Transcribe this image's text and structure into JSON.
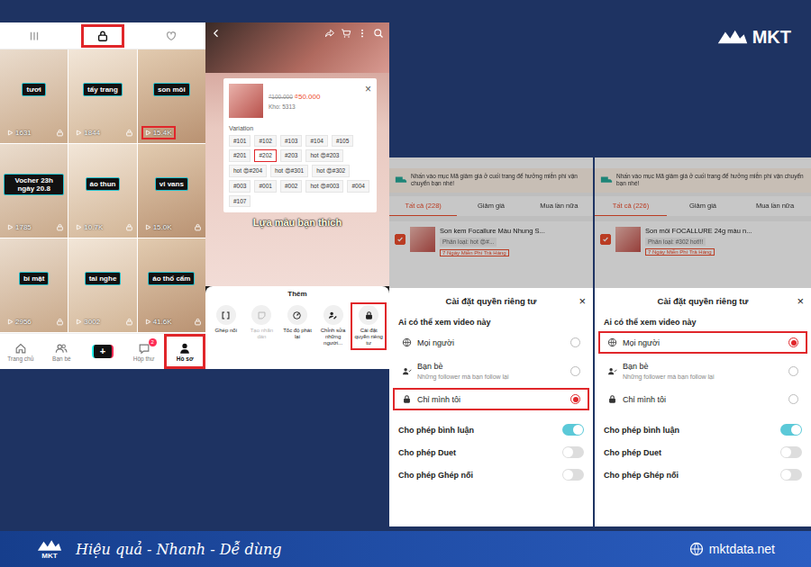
{
  "brand": {
    "name": "MKT"
  },
  "profile": {
    "tabs": [
      {
        "selected": false,
        "highlighted": false
      },
      {
        "selected": true,
        "highlighted": true
      },
      {
        "selected": false,
        "highlighted": false
      }
    ],
    "videos": [
      {
        "caption": "tươi",
        "views": "1631",
        "private": true,
        "highlighted": false
      },
      {
        "caption": "tẩy trang",
        "views": "1844",
        "private": true,
        "highlighted": false
      },
      {
        "caption": "son môi",
        "views": "15.4K",
        "private": false,
        "highlighted": true
      },
      {
        "caption": "Vocher 23h ngày 20.8",
        "views": "1785",
        "private": true,
        "highlighted": false
      },
      {
        "caption": "áo thun",
        "views": "10.7K",
        "private": true,
        "highlighted": false
      },
      {
        "caption": "vi vans",
        "views": "15.0K",
        "private": true,
        "highlighted": false
      },
      {
        "caption": "bí mật",
        "views": "2956",
        "private": true,
        "highlighted": false
      },
      {
        "caption": "tai nghe",
        "views": "3002",
        "private": true,
        "highlighted": false
      },
      {
        "caption": "áo thổ cẩm",
        "views": "41.6K",
        "private": true,
        "highlighted": false
      }
    ],
    "nav": [
      {
        "label": "Trang chủ",
        "kind": "tab",
        "selected": false,
        "highlighted": false,
        "badge": ""
      },
      {
        "label": "Bạn bè",
        "kind": "tab",
        "selected": false,
        "highlighted": false,
        "badge": ""
      },
      {
        "label": "+",
        "kind": "create",
        "selected": false,
        "highlighted": false,
        "badge": ""
      },
      {
        "label": "Hộp thư",
        "kind": "tab",
        "selected": false,
        "highlighted": false,
        "badge": "2"
      },
      {
        "label": "Hồ sơ",
        "kind": "tab",
        "selected": true,
        "highlighted": true,
        "badge": ""
      }
    ]
  },
  "video": {
    "caption": "Lựa màu bạn thích",
    "product": {
      "old_price": "₫100.000",
      "price": "₫50.000",
      "stock": "Kho: 5313",
      "close": "×",
      "variation_title": "Variation",
      "variations": [
        {
          "label": "#101",
          "selected": false
        },
        {
          "label": "#102",
          "selected": false
        },
        {
          "label": "#103",
          "selected": false
        },
        {
          "label": "#104",
          "selected": false
        },
        {
          "label": "#105",
          "selected": false
        },
        {
          "label": "#201",
          "selected": false
        },
        {
          "label": "#202",
          "selected": true
        },
        {
          "label": "#203",
          "selected": false
        },
        {
          "label": "hot 😍#203",
          "selected": false
        },
        {
          "label": "hot 😍#204",
          "selected": false
        },
        {
          "label": "hot 😍#301",
          "selected": false
        },
        {
          "label": "hot 😍#302",
          "selected": false
        },
        {
          "label": "#003",
          "selected": false
        },
        {
          "label": "#001",
          "selected": false
        },
        {
          "label": "#002",
          "selected": false
        },
        {
          "label": "hot 😍#003",
          "selected": false
        },
        {
          "label": "#004",
          "selected": false
        },
        {
          "label": "#107",
          "selected": false
        }
      ]
    }
  },
  "more_sheet": {
    "title": "Thêm",
    "actions": [
      {
        "label": "Ghép nối",
        "disabled": false,
        "highlighted": false
      },
      {
        "label": "Tạo nhãn dán",
        "disabled": true,
        "highlighted": false
      },
      {
        "label": "Tốc độ phát lại",
        "disabled": false,
        "highlighted": false
      },
      {
        "label": "Chỉnh sửa những người...",
        "disabled": false,
        "highlighted": false
      },
      {
        "label": "Cài đặt quyền riêng tư",
        "disabled": false,
        "highlighted": true
      }
    ]
  },
  "privacy_screens": [
    {
      "shop": {
        "notice": "Nhấn vào mục Mã giảm giá ở cuối trang để hưởng miễn phí vận chuyển bạn nhé!",
        "tabs": [
          {
            "label": "Tất cả (228)",
            "selected": true
          },
          {
            "label": "Giảm giá",
            "selected": false
          },
          {
            "label": "Mua lần nữa",
            "selected": false
          }
        ],
        "item": {
          "name": "Son kem Focallure Màu Nhung S...",
          "variant": "Phân loại: hot 😍#...",
          "badge": "7 Ngày Miễn Phí Trả Hàng",
          "checked": true
        }
      },
      "sheet": {
        "title": "Cài đặt quyền riêng tư",
        "close": "×",
        "question": "Ai có thể xem video này",
        "options": [
          {
            "label": "Mọi người",
            "sub": "",
            "selected": false,
            "highlighted": false
          },
          {
            "label": "Bạn bè",
            "sub": "Những follower mà bạn follow lại",
            "selected": false,
            "highlighted": false
          },
          {
            "label": "Chỉ mình tôi",
            "sub": "",
            "selected": true,
            "highlighted": true
          }
        ],
        "toggles": [
          {
            "label": "Cho phép bình luận",
            "on": true
          },
          {
            "label": "Cho phép Duet",
            "on": false
          },
          {
            "label": "Cho phép Ghép nối",
            "on": false
          }
        ]
      }
    },
    {
      "shop": {
        "notice": "Nhấn vào mục Mã giảm giá ở cuối trang để hưởng miễn phí vận chuyển bạn nhé!",
        "tabs": [
          {
            "label": "Tất cả (226)",
            "selected": true
          },
          {
            "label": "Giảm giá",
            "selected": false
          },
          {
            "label": "Mua lần nữa",
            "selected": false
          }
        ],
        "item": {
          "name": "Son môi FOCALLURE 24g màu n...",
          "variant": "Phân loại: #302 hot!!!",
          "badge": "7 Ngày Miễn Phí Trả Hàng",
          "checked": true
        }
      },
      "sheet": {
        "title": "Cài đặt quyền riêng tư",
        "close": "×",
        "question": "Ai có thể xem video này",
        "options": [
          {
            "label": "Mọi người",
            "sub": "",
            "selected": true,
            "highlighted": true
          },
          {
            "label": "Bạn bè",
            "sub": "Những follower mà bạn follow lại",
            "selected": false,
            "highlighted": false
          },
          {
            "label": "Chỉ mình tôi",
            "sub": "",
            "selected": false,
            "highlighted": false
          }
        ],
        "toggles": [
          {
            "label": "Cho phép bình luận",
            "on": true
          },
          {
            "label": "Cho phép Duet",
            "on": false
          },
          {
            "label": "Cho phép Ghép nối",
            "on": false
          }
        ]
      }
    }
  ],
  "footer": {
    "slogan": "Hiệu quả - Nhanh - Dễ dùng",
    "website": "mktdata.net"
  }
}
